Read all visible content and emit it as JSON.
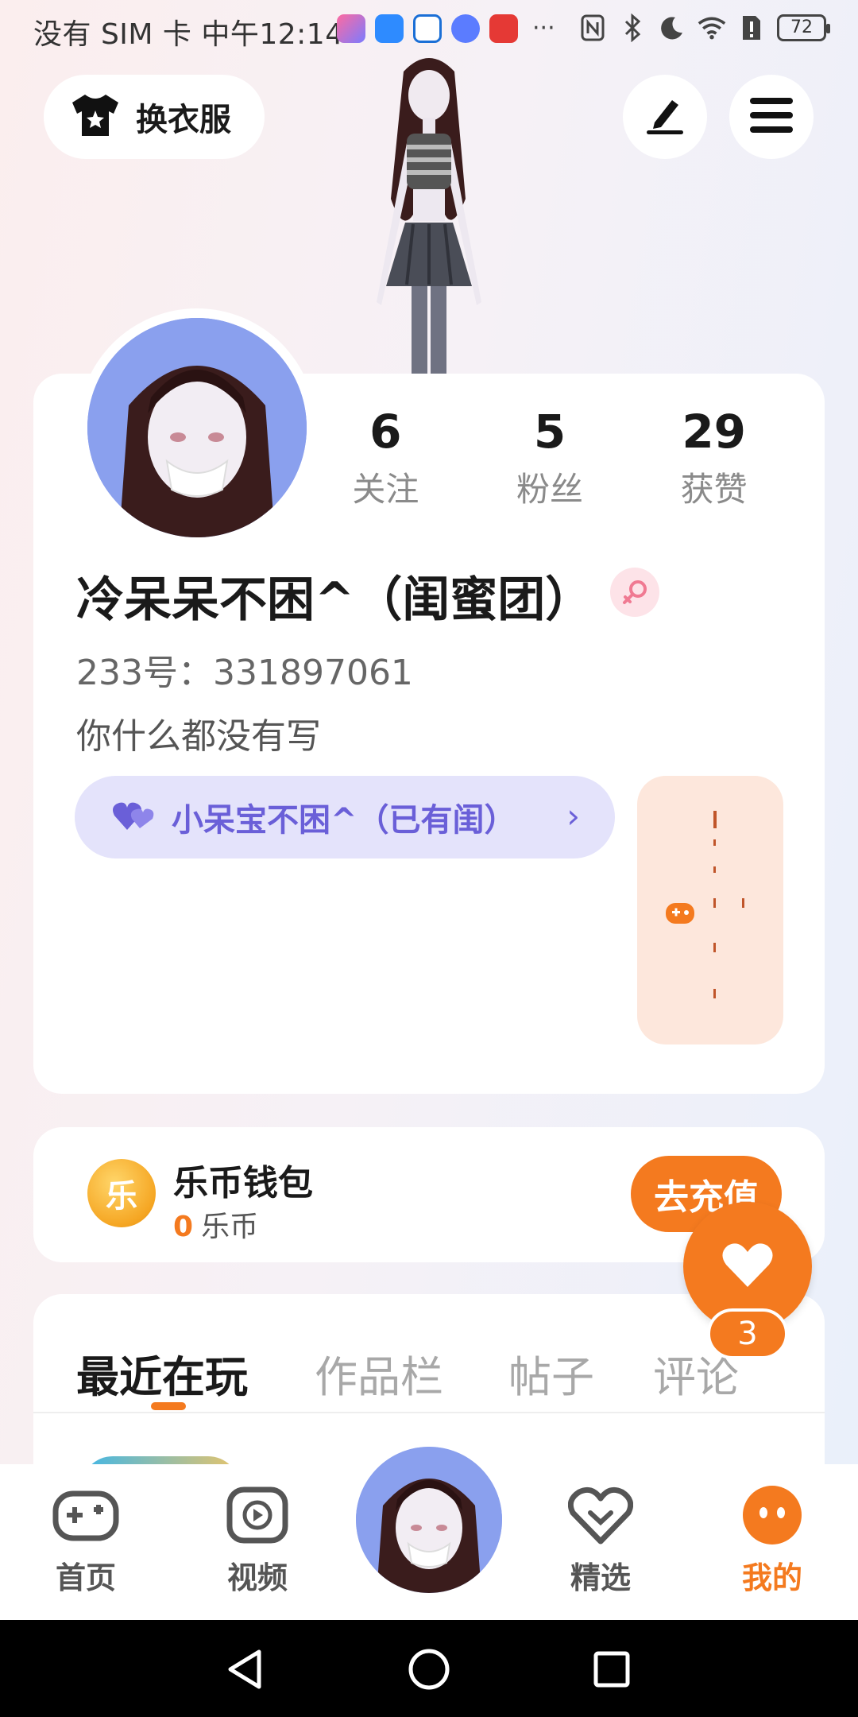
{
  "status_bar": {
    "text": "没有 SIM 卡 中午12:14",
    "more": "···",
    "battery": "72"
  },
  "top": {
    "outfit_label": "换衣服",
    "edit_icon": "pen-icon",
    "menu_icon": "hamburger-icon"
  },
  "profile": {
    "stats": [
      {
        "value": "6",
        "label": "关注"
      },
      {
        "value": "5",
        "label": "粉丝"
      },
      {
        "value": "29",
        "label": "获赞"
      }
    ],
    "nickname": "冷呆呆不困^（闺蜜团）",
    "gender_icon": "female-icon",
    "uid": "233号：331897061",
    "bio": "你什么都没有写",
    "bestie_label": "小呆宝不困^（已有闺）",
    "bestie_chevron": "›"
  },
  "wallet": {
    "title": "乐币钱包",
    "balance": "0",
    "unit": "乐币",
    "coin_glyph": "乐",
    "recharge_label": "去充值"
  },
  "fab": {
    "badge": "3"
  },
  "tabs": [
    {
      "label": "最近在玩",
      "active": true
    },
    {
      "label": "作品栏",
      "active": false
    },
    {
      "label": "帖子",
      "active": false
    },
    {
      "label": "评论",
      "active": false
    }
  ],
  "bottom_nav": [
    {
      "label": "首页",
      "icon": "gamepad-icon",
      "active": false
    },
    {
      "label": "视频",
      "icon": "video-play-icon",
      "active": false
    },
    {
      "label": "精选",
      "icon": "heart-diamond-icon",
      "active": false
    },
    {
      "label": "我的",
      "icon": "face-icon",
      "active": true
    }
  ],
  "colors": {
    "accent": "#f47a1f",
    "bestie_bg": "#e4e3fb",
    "bestie_text": "#6a5fd8"
  }
}
